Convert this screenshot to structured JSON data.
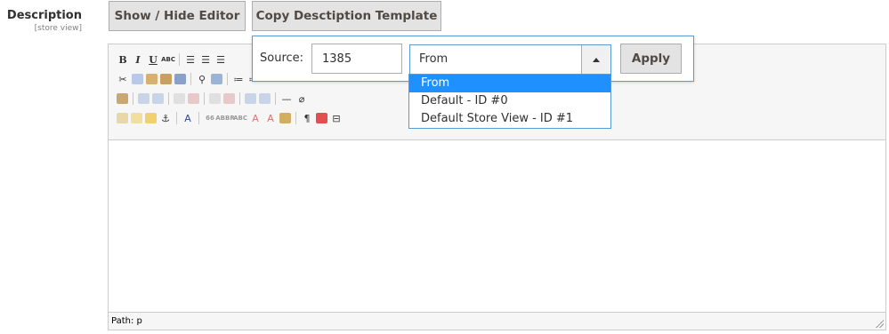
{
  "field": {
    "label": "Description",
    "scope": "[store view]"
  },
  "buttons": {
    "toggle_editor": "Show / Hide Editor",
    "copy_template": "Copy Desctiption Template"
  },
  "copy_popup": {
    "source_label": "Source:",
    "source_value": "1385",
    "select_value": "From",
    "apply_label": "Apply",
    "options": [
      "From",
      "Default - ID #0",
      "Default Store View - ID #1"
    ],
    "selected_option": "From"
  },
  "editor": {
    "status_path": "Path: p",
    "content": ""
  },
  "colors": {
    "accent": "#1e90ff",
    "border_focus": "#5a9bd4",
    "button_bg": "#e3e3e3"
  }
}
